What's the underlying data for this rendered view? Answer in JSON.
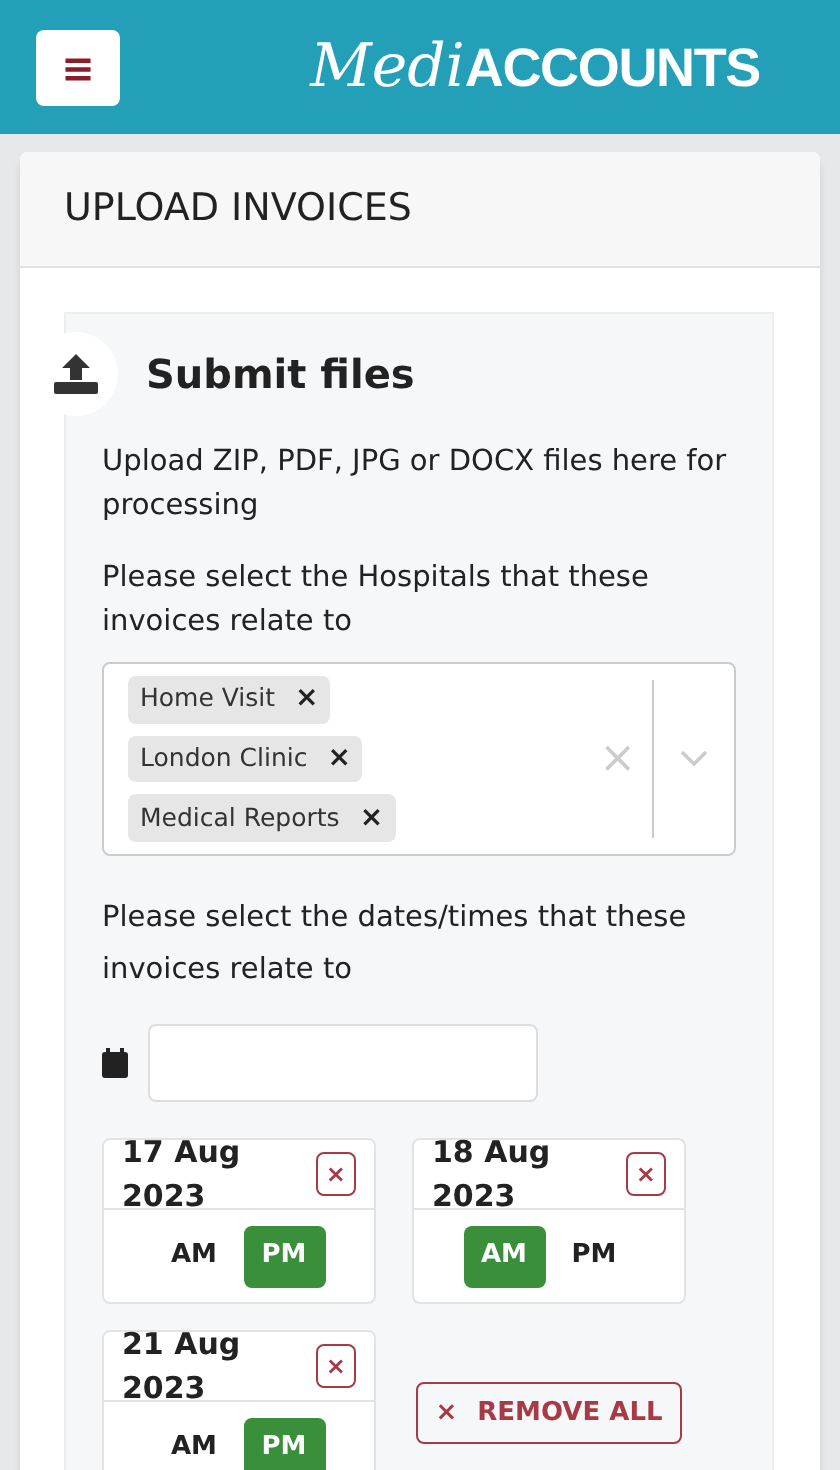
{
  "header": {
    "menu_icon": "≡",
    "logo_script": "Medi",
    "logo_text": "ACCOUNTS"
  },
  "card": {
    "title": "UPLOAD INVOICES"
  },
  "panel": {
    "title": "Submit files",
    "description": "Upload ZIP, PDF, JPG or DOCX files here for processing",
    "hospitals_label": "Please select the Hospitals that these invoices relate to",
    "hospitals": [
      {
        "label": "Home Visit",
        "remove": "×"
      },
      {
        "label": "London Clinic",
        "remove": "×"
      },
      {
        "label": "Medical Reports",
        "remove": "×"
      }
    ],
    "clear": "×",
    "dates_label": "Please select the dates/times that these invoices relate to",
    "dates": [
      {
        "date": "17 Aug 2023",
        "remove": "×",
        "periods": [
          {
            "label": "AM",
            "selected": false
          },
          {
            "label": "PM",
            "selected": true
          }
        ]
      },
      {
        "date": "18 Aug 2023",
        "remove": "×",
        "periods": [
          {
            "label": "AM",
            "selected": true
          },
          {
            "label": "PM",
            "selected": false
          }
        ]
      },
      {
        "date": "21 Aug 2023",
        "remove": "×",
        "periods": [
          {
            "label": "AM",
            "selected": false
          },
          {
            "label": "PM",
            "selected": true
          }
        ]
      }
    ],
    "remove_all": {
      "icon": "×",
      "label": "REMOVE ALL"
    }
  }
}
